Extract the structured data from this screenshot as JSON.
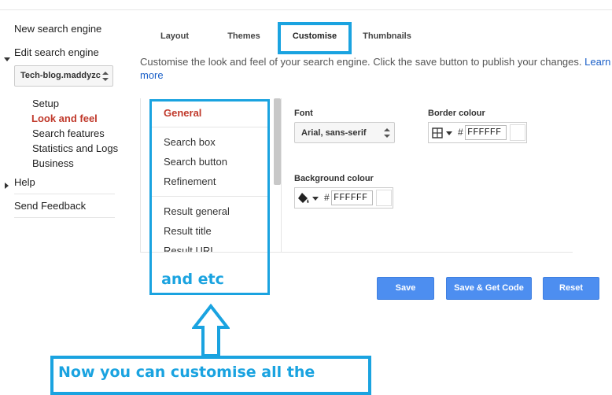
{
  "sidebar": {
    "new_engine": "New search engine",
    "edit_engine": "Edit search engine",
    "engine_select_value": "Tech-blog.maddyzc",
    "sub_items": [
      "Setup",
      "Look and feel",
      "Search features",
      "Statistics and Logs",
      "Business"
    ],
    "help": "Help",
    "send_feedback": "Send Feedback"
  },
  "tabs": [
    "Layout",
    "Themes",
    "Customise",
    "Thumbnails"
  ],
  "active_tab": "Customise",
  "description": {
    "text": "Customise the look and feel of your search engine. Click the save button to publish your changes.",
    "more_link": "Learn more"
  },
  "sections": {
    "header": "General",
    "group1": [
      "Search box",
      "Search button",
      "Refinement"
    ],
    "group2": [
      "Result general",
      "Result title",
      "Result URL"
    ]
  },
  "font": {
    "label": "Font",
    "value": "Arial, sans-serif"
  },
  "border_colour": {
    "label": "Border colour",
    "hash": "#",
    "value": "FFFFFF"
  },
  "background_colour": {
    "label": "Background colour",
    "hash": "#",
    "value": "FFFFFF"
  },
  "buttons": {
    "save": "Save",
    "save_get_code": "Save & Get Code",
    "reset": "Reset"
  },
  "annotations": {
    "and_etc": "and etc",
    "customise_all": "Now you can customise all the"
  },
  "colors": {
    "accent_blue": "#1aa3e0",
    "button_blue": "#4d8ef0",
    "active_red": "#c0392b"
  },
  "icons": [
    "grid-border-icon",
    "paint-bucket-icon",
    "dropdown-arrow-icon",
    "up-down-arrow-icon",
    "up-arrow-callout"
  ]
}
